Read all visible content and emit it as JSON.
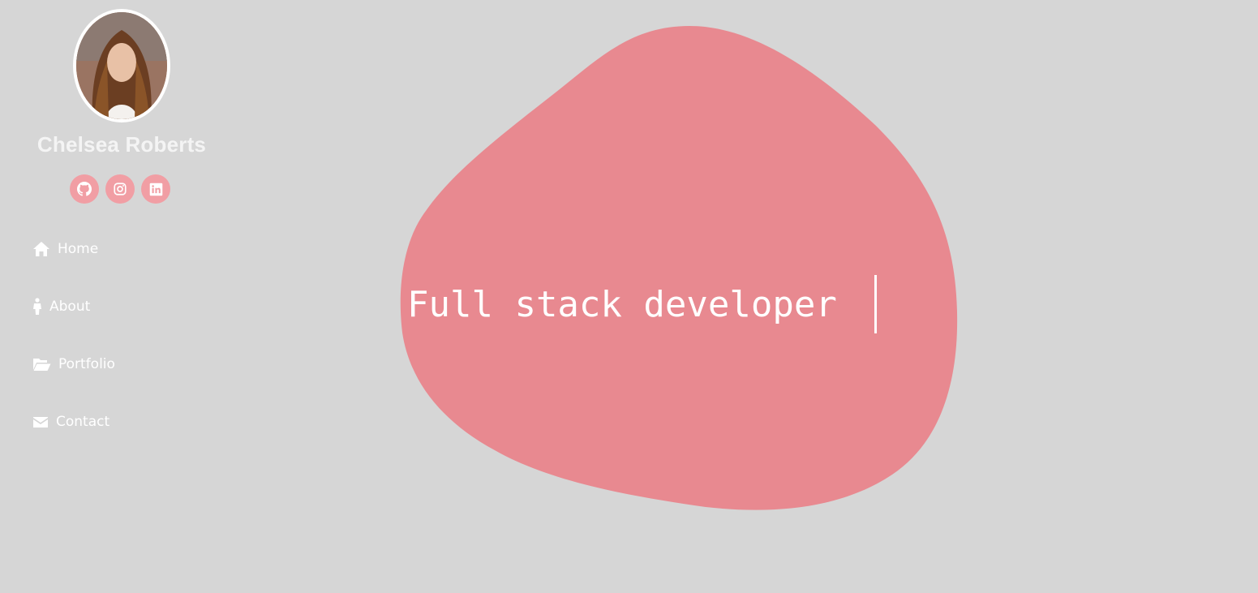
{
  "profile": {
    "name": "Chelsea Roberts"
  },
  "socials": [
    {
      "icon": "github-icon"
    },
    {
      "icon": "instagram-icon"
    },
    {
      "icon": "linkedin-icon"
    }
  ],
  "nav": {
    "items": [
      {
        "label": "Home",
        "icon": "home-icon"
      },
      {
        "label": "About",
        "icon": "person-icon"
      },
      {
        "label": "Portfolio",
        "icon": "folder-open-icon"
      },
      {
        "label": "Contact",
        "icon": "envelope-icon"
      }
    ]
  },
  "hero": {
    "typed_text": "Full stack developer"
  },
  "colors": {
    "background": "#d6d6d6",
    "blob": "#e88990",
    "social_bg": "#f19ea4",
    "text": "#ffffff"
  }
}
